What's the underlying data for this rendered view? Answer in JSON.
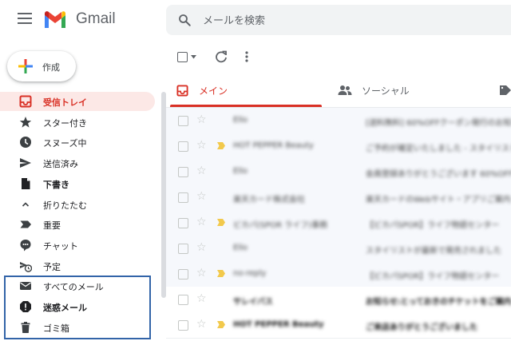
{
  "header": {
    "app_name": "Gmail",
    "search_placeholder": "メールを検索"
  },
  "compose": {
    "label": "作成"
  },
  "sidebar": {
    "items": [
      {
        "label": "受信トレイ",
        "icon": "inbox-icon",
        "active": true
      },
      {
        "label": "スター付き",
        "icon": "star-icon"
      },
      {
        "label": "スヌーズ中",
        "icon": "clock-icon"
      },
      {
        "label": "送信済み",
        "icon": "send-icon"
      },
      {
        "label": "下書き",
        "icon": "draft-icon",
        "bold": true
      },
      {
        "label": "折りたたむ",
        "icon": "chevron-up-icon"
      },
      {
        "label": "重要",
        "icon": "important-icon"
      },
      {
        "label": "チャット",
        "icon": "chat-icon"
      },
      {
        "label": "予定",
        "icon": "scheduled-icon"
      },
      {
        "label": "すべてのメール",
        "icon": "all-mail-icon"
      },
      {
        "label": "迷惑メール",
        "icon": "spam-icon",
        "bold": true
      },
      {
        "label": "ゴミ箱",
        "icon": "trash-icon"
      }
    ]
  },
  "tabs": [
    {
      "label": "メイン",
      "icon": "inbox-tab-icon",
      "active": true
    },
    {
      "label": "ソーシャル",
      "icon": "people-icon"
    }
  ],
  "emails": [
    {
      "sender": "Ello",
      "subject": "[送料無料] 60%OFFクーポン発行のお知らせ"
    },
    {
      "sender": "HOT PEPPER Beauty",
      "subject": "ご予約が確定いたしました - スタイリスト"
    },
    {
      "sender": "Ello",
      "subject": "会員登録ありがとうございます 60%OFF"
    },
    {
      "sender": "楽天カード株式会社",
      "subject": "楽天カードのWebサイト・アプリご案内"
    },
    {
      "sender": "ビカパ(SPOR ライフ)事務",
      "subject": "【ビカパSPOR】ライフ物語センター"
    },
    {
      "sender": "Ello",
      "subject": "スタイリストが最新で発売されました"
    },
    {
      "sender": "no-reply",
      "subject": "【ビカパSPOR】ライフ物語センター"
    },
    {
      "sender": "サレイバス",
      "subject": "お知らせ:とっておきのチケットをご案内"
    },
    {
      "sender": "HOT PEPPER Beauty",
      "subject": "ご来店ありがとうございました"
    }
  ],
  "colors": {
    "accent_red": "#d93025",
    "active_bg": "#fce8e6",
    "highlight_border": "#3264a8",
    "important_yellow": "#f2c94c"
  }
}
